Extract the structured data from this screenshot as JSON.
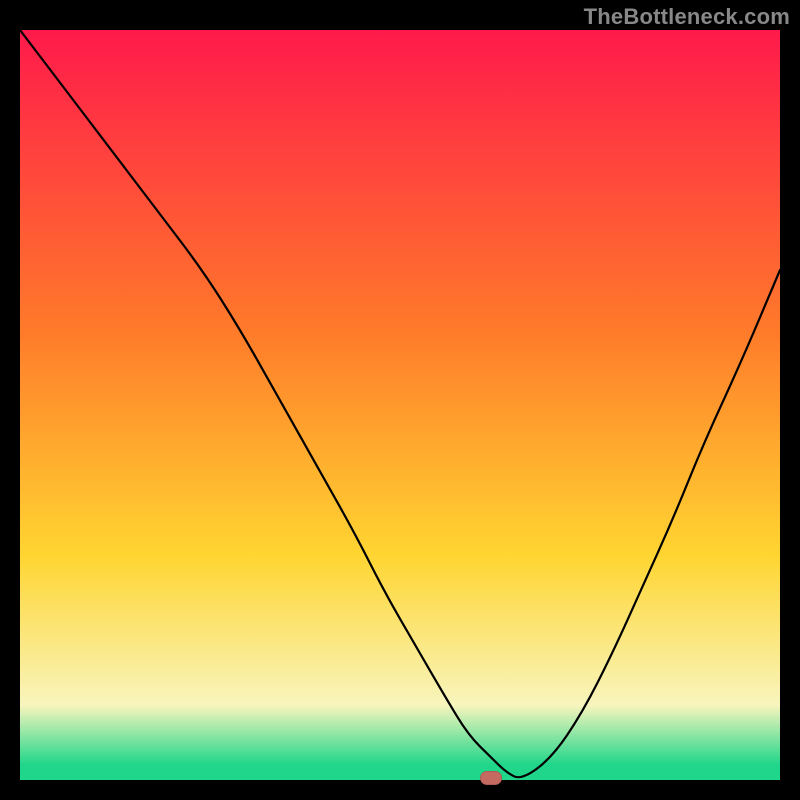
{
  "watermark": "TheBottleneck.com",
  "colors": {
    "frame_bg": "#000000",
    "gradient_top": "#ff1a4b",
    "gradient_mid_high": "#ff7a2a",
    "gradient_mid": "#ffd531",
    "gradient_low": "#f8f5bd",
    "gradient_green": "#1fd68a",
    "curve": "#000000",
    "marker_fill": "#c46a60"
  },
  "chart_data": {
    "type": "line",
    "title": "",
    "xlabel": "",
    "ylabel": "",
    "xlim": [
      0,
      100
    ],
    "ylim": [
      0,
      100
    ],
    "x": [
      0,
      6,
      12,
      18,
      24,
      29,
      34,
      39,
      44,
      48,
      52,
      56,
      59,
      62,
      64,
      66,
      70,
      74,
      78,
      82,
      86,
      90,
      95,
      100
    ],
    "values": [
      100,
      92,
      84,
      76,
      68,
      60,
      51,
      42,
      33,
      25,
      18,
      11,
      6,
      3,
      1,
      0,
      3,
      9,
      17,
      26,
      35,
      45,
      56,
      68
    ],
    "flat_segment": {
      "x_from": 56,
      "x_to": 64,
      "y": 0
    },
    "marker": {
      "x": 62,
      "y": 0
    },
    "gradient_stops": [
      {
        "offset": 0.0,
        "key": "gradient_top"
      },
      {
        "offset": 0.4,
        "key": "gradient_mid_high"
      },
      {
        "offset": 0.7,
        "key": "gradient_mid"
      },
      {
        "offset": 0.9,
        "key": "gradient_low"
      },
      {
        "offset": 0.98,
        "key": "gradient_green"
      },
      {
        "offset": 1.0,
        "key": "gradient_green"
      }
    ]
  }
}
